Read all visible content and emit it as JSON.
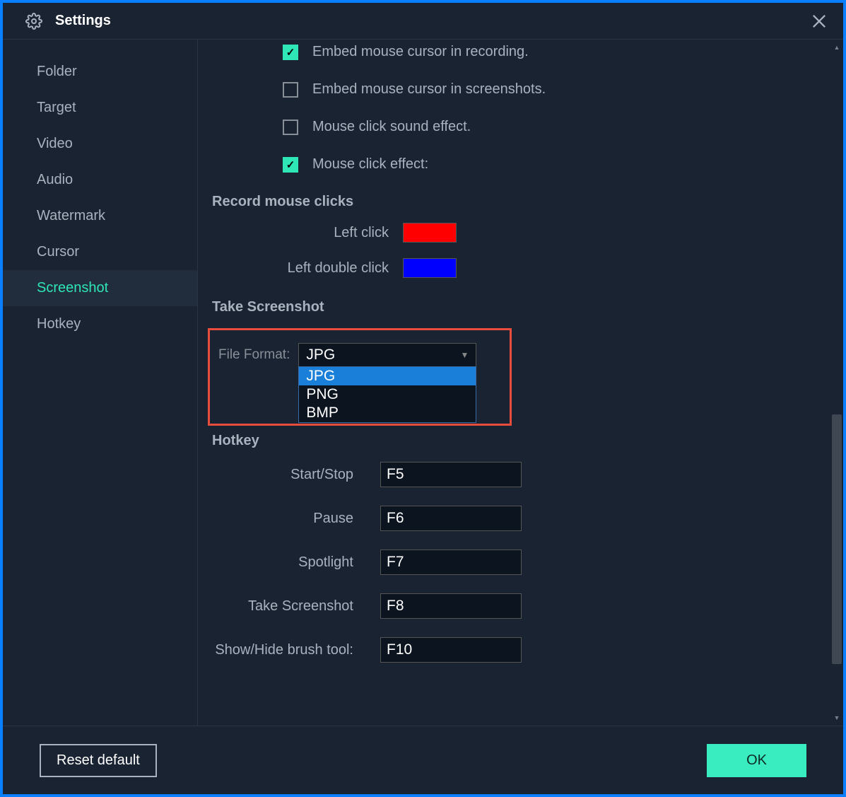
{
  "title": "Settings",
  "sidebar": {
    "items": [
      {
        "label": "Folder"
      },
      {
        "label": "Target"
      },
      {
        "label": "Video"
      },
      {
        "label": "Audio"
      },
      {
        "label": "Watermark"
      },
      {
        "label": "Cursor"
      },
      {
        "label": "Screenshot"
      },
      {
        "label": "Hotkey"
      }
    ]
  },
  "checkboxes": {
    "embed_cursor_recording": "Embed mouse cursor in recording.",
    "embed_cursor_screenshots": "Embed mouse cursor in screenshots.",
    "click_sound": "Mouse click sound effect.",
    "click_effect": "Mouse click effect:"
  },
  "record_clicks": {
    "heading": "Record mouse clicks",
    "left_click": "Left click",
    "left_double_click": "Left double click",
    "left_click_color": "#ff0000",
    "left_double_click_color": "#0000ff"
  },
  "take_screenshot": {
    "heading": "Take Screenshot",
    "file_format_label": "File Format:",
    "selected": "JPG",
    "options": [
      "JPG",
      "PNG",
      "BMP"
    ]
  },
  "hotkey": {
    "heading": "Hotkey",
    "rows": [
      {
        "label": "Start/Stop",
        "value": "F5"
      },
      {
        "label": "Pause",
        "value": "F6"
      },
      {
        "label": "Spotlight",
        "value": "F7"
      },
      {
        "label": "Take Screenshot",
        "value": "F8"
      },
      {
        "label": "Show/Hide brush tool:",
        "value": "F10"
      }
    ]
  },
  "footer": {
    "reset": "Reset default",
    "ok": "OK"
  }
}
